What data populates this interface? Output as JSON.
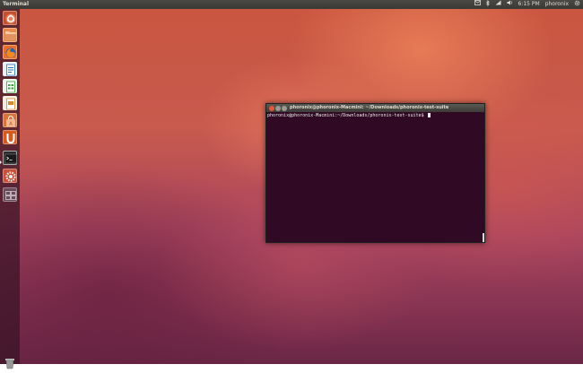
{
  "top_panel": {
    "app_title": "Terminal",
    "tray": {
      "mail_icon": "envelope-icon",
      "bluetooth_icon": "bluetooth-icon",
      "network_icon": "network-icon",
      "volume_icon": "speaker-icon",
      "clock": "6:15 PM",
      "user": "phoronix",
      "session_icon": "gear-icon"
    }
  },
  "launcher": {
    "items": [
      {
        "name": "dash-home",
        "icon": "ubuntu-logo-icon",
        "color": "#c24f2f"
      },
      {
        "name": "files",
        "icon": "folder-icon",
        "color": "#e78a4b"
      },
      {
        "name": "firefox",
        "icon": "firefox-icon",
        "color": "#3f72b8"
      },
      {
        "name": "libreoffice-writer",
        "icon": "writer-icon",
        "color": "#2a73b8"
      },
      {
        "name": "libreoffice-calc",
        "icon": "calc-icon",
        "color": "#39a138"
      },
      {
        "name": "libreoffice-impress",
        "icon": "impress-icon",
        "color": "#d8892b"
      },
      {
        "name": "software-center",
        "icon": "shopping-bag-icon",
        "color": "#d7733c"
      },
      {
        "name": "ubuntu-one",
        "icon": "ubuntu-one-icon",
        "color": "#d35a20"
      },
      {
        "name": "terminal",
        "icon": "terminal-icon",
        "color": "#2b2b2b"
      },
      {
        "name": "system-settings",
        "icon": "settings-icon",
        "color": "#c8523c"
      },
      {
        "name": "workspace-switcher",
        "icon": "workspaces-icon",
        "color": "#6b4a5a"
      }
    ],
    "trash_icon": "trash-icon"
  },
  "terminal": {
    "title": "phoronix@phoronix-Macmini: ~/Downloads/phoronix-test-suite",
    "prompt": "phoronix@phoronix-Macmini:~/Downloads/phoronix-test-suite$ ",
    "background": "#300a24",
    "text_color": "#eeeeec",
    "close_color": "#e1593a",
    "minimize_color": "#9a9892",
    "maximize_color": "#9a9892"
  }
}
